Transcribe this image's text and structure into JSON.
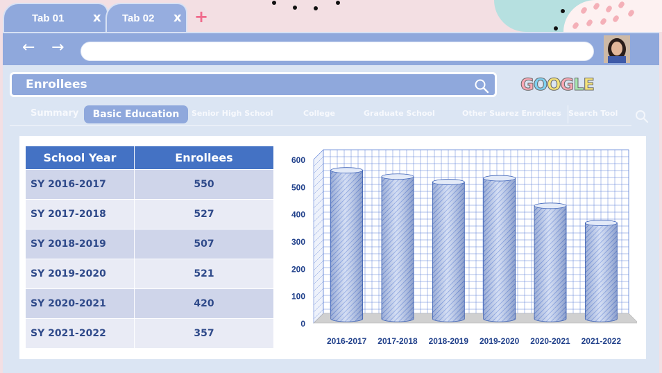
{
  "tabs": [
    {
      "label": "Tab 01",
      "close": "x"
    },
    {
      "label": "Tab 02",
      "close": "x"
    }
  ],
  "new_tab_symbol": "+",
  "toolbar": {
    "back": "←",
    "forward": "→",
    "url": ""
  },
  "search": {
    "query": "Enrollees"
  },
  "logo": {
    "letters": [
      "G",
      "O",
      "O",
      "G",
      "L",
      "E"
    ],
    "colors": [
      "#f9a8b4",
      "#7fd0f0",
      "#f4e27a",
      "#f9a8b4",
      "#a8e6b0",
      "#f4e27a"
    ]
  },
  "nav": {
    "summary": "Summary",
    "basic_education": "Basic Education",
    "senior_high": "Senior High School",
    "college": "College",
    "graduate": "Graduate School",
    "other": "Other Suarez Enrollees",
    "search_tool": "Search Tool"
  },
  "table": {
    "headers": [
      "School Year",
      "Enrollees"
    ],
    "rows": [
      {
        "year": "SY 2016-2017",
        "value": "550"
      },
      {
        "year": "SY 2017-2018",
        "value": "527"
      },
      {
        "year": "SY 2018-2019",
        "value": "507"
      },
      {
        "year": "SY 2019-2020",
        "value": "521"
      },
      {
        "year": "SY 2020-2021",
        "value": "420"
      },
      {
        "year": "SY 2021-2022",
        "value": "357"
      }
    ]
  },
  "chart_data": {
    "type": "bar",
    "categories": [
      "2016-2017",
      "2017-2018",
      "2018-2019",
      "2019-2020",
      "2020-2021",
      "2021-2022"
    ],
    "values": [
      550,
      527,
      507,
      521,
      420,
      357
    ],
    "ylim": [
      0,
      600
    ],
    "yticks": [
      0,
      100,
      200,
      300,
      400,
      500,
      600
    ],
    "grid": true,
    "bar_shape": "cylinder",
    "colors": {
      "bar": "#8fa8dc",
      "grid": "#5b7fd6",
      "axis_text": "#1f3f8a"
    }
  }
}
